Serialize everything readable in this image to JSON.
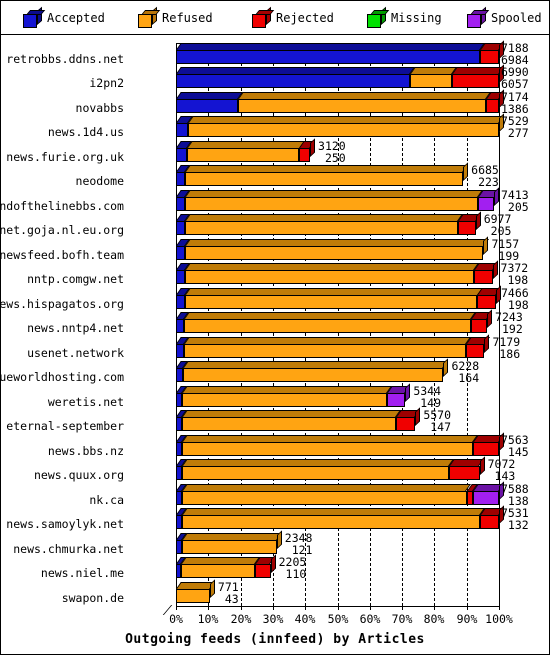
{
  "legend": {
    "items": [
      {
        "label": "Accepted",
        "color": "#1414d2",
        "side": "#0b0b8c",
        "icon": "cube-icon"
      },
      {
        "label": "Refused",
        "color": "#ffa412",
        "side": "#b8750a",
        "icon": "cube-icon"
      },
      {
        "label": "Rejected",
        "color": "#f00000",
        "side": "#a50000",
        "icon": "cube-icon"
      },
      {
        "label": "Missing",
        "color": "#00e000",
        "side": "#009c00",
        "icon": "cube-icon"
      },
      {
        "label": "Spooled",
        "color": "#a21ff0",
        "side": "#6b12a5",
        "icon": "cube-icon"
      }
    ]
  },
  "chart_data": {
    "type": "bar",
    "orientation": "horizontal",
    "stacked": true,
    "percent": true,
    "title": "",
    "xlabel": "Outgoing feeds (innfeed) by Articles",
    "ylabel": "",
    "xlim": [
      0,
      100
    ],
    "xticks": [
      "0%",
      "10%",
      "20%",
      "30%",
      "40%",
      "50%",
      "60%",
      "70%",
      "80%",
      "90%",
      "100%"
    ],
    "xtickvalues": [
      0,
      10,
      20,
      30,
      40,
      50,
      60,
      70,
      80,
      90,
      100
    ],
    "grid": true,
    "legend_position": "top",
    "series": [
      {
        "name": "Accepted",
        "color": "#1414d2"
      },
      {
        "name": "Refused",
        "color": "#ffa412"
      },
      {
        "name": "Rejected",
        "color": "#f00000"
      },
      {
        "name": "Missing",
        "color": "#00e000"
      },
      {
        "name": "Spooled",
        "color": "#a21ff0"
      }
    ],
    "categories": [
      "retrobbs.ddns.net",
      "i2pn2",
      "novabbs",
      "news.1d4.us",
      "news.furie.org.uk",
      "neodome",
      "newsfeed.endofthelinebbs.com",
      "usenet.goja.nl.eu.org",
      "newsfeed.bofh.team",
      "nntp.comgw.net",
      "news.hispagatos.org",
      "news.nntp4.net",
      "usenet.network",
      "usenet.blueworldhosting.com",
      "weretis.net",
      "eternal-september",
      "news.bbs.nz",
      "news.quux.org",
      "nk.ca",
      "news.samoylyk.net",
      "news.chmurka.net",
      "news.niel.me",
      "swapon.de"
    ],
    "rows": [
      {
        "label": "retrobbs.ddns.net",
        "total": 7188,
        "second": 6984,
        "barpct": 100,
        "segments": [
          {
            "s": "Accepted",
            "pct": 94.0
          },
          {
            "s": "Rejected",
            "pct": 6.0
          }
        ]
      },
      {
        "label": "i2pn2",
        "total": 6990,
        "second": 6057,
        "barpct": 100,
        "segments": [
          {
            "s": "Accepted",
            "pct": 72.5
          },
          {
            "s": "Refused",
            "pct": 13.0
          },
          {
            "s": "Rejected",
            "pct": 14.5
          }
        ]
      },
      {
        "label": "novabbs",
        "total": 7174,
        "second": 1386,
        "barpct": 100,
        "segments": [
          {
            "s": "Accepted",
            "pct": 19.3
          },
          {
            "s": "Refused",
            "pct": 76.7
          },
          {
            "s": "Rejected",
            "pct": 4.0
          }
        ]
      },
      {
        "label": "news.1d4.us",
        "total": 7529,
        "second": 277,
        "barpct": 100,
        "segments": [
          {
            "s": "Accepted",
            "pct": 3.7
          },
          {
            "s": "Refused",
            "pct": 96.3
          }
        ]
      },
      {
        "label": "news.furie.org.uk",
        "total": 3120,
        "second": 250,
        "barpct": 41.5,
        "segments": [
          {
            "s": "Accepted",
            "pct": 8.0
          },
          {
            "s": "Refused",
            "pct": 84.0
          },
          {
            "s": "Rejected",
            "pct": 8.0
          }
        ]
      },
      {
        "label": "neodome",
        "total": 6685,
        "second": 223,
        "barpct": 88.9,
        "segments": [
          {
            "s": "Accepted",
            "pct": 3.3
          },
          {
            "s": "Refused",
            "pct": 96.7
          }
        ]
      },
      {
        "label": "newsfeed.endofthelinebbs.com",
        "total": 7413,
        "second": 205,
        "barpct": 98.5,
        "segments": [
          {
            "s": "Accepted",
            "pct": 2.8
          },
          {
            "s": "Refused",
            "pct": 92.0
          },
          {
            "s": "Spooled",
            "pct": 5.2
          }
        ]
      },
      {
        "label": "usenet.goja.nl.eu.org",
        "total": 6977,
        "second": 205,
        "barpct": 92.8,
        "segments": [
          {
            "s": "Accepted",
            "pct": 2.9
          },
          {
            "s": "Refused",
            "pct": 91.1
          },
          {
            "s": "Rejected",
            "pct": 6.0
          }
        ]
      },
      {
        "label": "newsfeed.bofh.team",
        "total": 7157,
        "second": 199,
        "barpct": 95.2,
        "segments": [
          {
            "s": "Accepted",
            "pct": 2.8
          },
          {
            "s": "Refused",
            "pct": 97.2
          }
        ]
      },
      {
        "label": "nntp.comgw.net",
        "total": 7372,
        "second": 198,
        "barpct": 98.0,
        "segments": [
          {
            "s": "Accepted",
            "pct": 2.7
          },
          {
            "s": "Refused",
            "pct": 91.3
          },
          {
            "s": "Rejected",
            "pct": 6.0
          }
        ]
      },
      {
        "label": "news.hispagatos.org",
        "total": 7466,
        "second": 198,
        "barpct": 99.2,
        "segments": [
          {
            "s": "Accepted",
            "pct": 2.7
          },
          {
            "s": "Refused",
            "pct": 91.3
          },
          {
            "s": "Rejected",
            "pct": 6.0
          }
        ]
      },
      {
        "label": "news.nntp4.net",
        "total": 7243,
        "second": 192,
        "barpct": 96.3,
        "segments": [
          {
            "s": "Accepted",
            "pct": 2.7
          },
          {
            "s": "Refused",
            "pct": 92.3
          },
          {
            "s": "Rejected",
            "pct": 5.0
          }
        ]
      },
      {
        "label": "usenet.network",
        "total": 7179,
        "second": 186,
        "barpct": 95.5,
        "segments": [
          {
            "s": "Accepted",
            "pct": 2.6
          },
          {
            "s": "Refused",
            "pct": 91.4
          },
          {
            "s": "Rejected",
            "pct": 6.0
          }
        ]
      },
      {
        "label": "usenet.blueworldhosting.com",
        "total": 6228,
        "second": 164,
        "barpct": 82.8,
        "segments": [
          {
            "s": "Accepted",
            "pct": 2.7
          },
          {
            "s": "Refused",
            "pct": 97.3
          }
        ]
      },
      {
        "label": "weretis.net",
        "total": 5344,
        "second": 149,
        "barpct": 71.0,
        "segments": [
          {
            "s": "Accepted",
            "pct": 2.8
          },
          {
            "s": "Refused",
            "pct": 89.2
          },
          {
            "s": "Spooled",
            "pct": 8.0
          }
        ]
      },
      {
        "label": "eternal-september",
        "total": 5570,
        "second": 147,
        "barpct": 74.1,
        "segments": [
          {
            "s": "Accepted",
            "pct": 2.7
          },
          {
            "s": "Refused",
            "pct": 89.3
          },
          {
            "s": "Rejected",
            "pct": 8.0
          }
        ]
      },
      {
        "label": "news.bbs.nz",
        "total": 7563,
        "second": 145,
        "barpct": 100,
        "segments": [
          {
            "s": "Accepted",
            "pct": 2.0
          },
          {
            "s": "Refused",
            "pct": 90.0
          },
          {
            "s": "Rejected",
            "pct": 8.0
          }
        ]
      },
      {
        "label": "news.quux.org",
        "total": 7072,
        "second": 143,
        "barpct": 94.0,
        "segments": [
          {
            "s": "Accepted",
            "pct": 2.0
          },
          {
            "s": "Refused",
            "pct": 88.0
          },
          {
            "s": "Rejected",
            "pct": 10.0
          }
        ]
      },
      {
        "label": "nk.ca",
        "total": 7588,
        "second": 138,
        "barpct": 100,
        "segments": [
          {
            "s": "Accepted",
            "pct": 2.0
          },
          {
            "s": "Refused",
            "pct": 88.0
          },
          {
            "s": "Rejected",
            "pct": 2.0
          },
          {
            "s": "Spooled",
            "pct": 8.0
          }
        ]
      },
      {
        "label": "news.samoylyk.net",
        "total": 7531,
        "second": 132,
        "barpct": 100,
        "segments": [
          {
            "s": "Accepted",
            "pct": 1.8
          },
          {
            "s": "Refused",
            "pct": 92.2
          },
          {
            "s": "Rejected",
            "pct": 6.0
          }
        ]
      },
      {
        "label": "news.chmurka.net",
        "total": 2348,
        "second": 121,
        "barpct": 31.2,
        "segments": [
          {
            "s": "Accepted",
            "pct": 5.5
          },
          {
            "s": "Refused",
            "pct": 94.5
          }
        ]
      },
      {
        "label": "news.niel.me",
        "total": 2205,
        "second": 110,
        "barpct": 29.3,
        "segments": [
          {
            "s": "Accepted",
            "pct": 5.5
          },
          {
            "s": "Refused",
            "pct": 78.5
          },
          {
            "s": "Rejected",
            "pct": 16.0
          }
        ]
      },
      {
        "label": "swapon.de",
        "total": 771,
        "second": 43,
        "barpct": 10.5,
        "segments": [
          {
            "s": "Refused",
            "pct": 100
          }
        ]
      }
    ]
  }
}
